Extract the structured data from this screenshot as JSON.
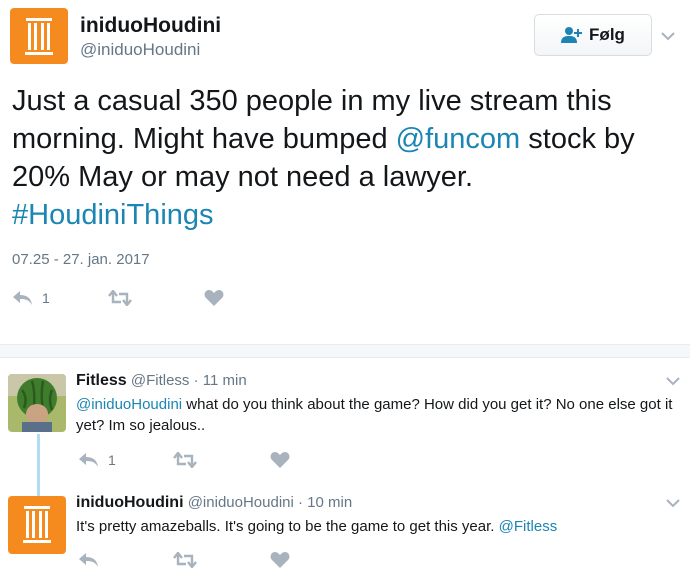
{
  "main_tweet": {
    "author_name": "iniduoHoudini",
    "author_handle": "@iniduoHoudini",
    "follow_label": "Følg",
    "text_parts": [
      {
        "text": "Just a casual 350 people in my live stream this morning. Might have bumped ",
        "kind": "text"
      },
      {
        "text": "@funcom",
        "kind": "link"
      },
      {
        "text": " stock by 20% May or may not need a lawyer. ",
        "kind": "text"
      },
      {
        "text": "#HoudiniThings",
        "kind": "link"
      }
    ],
    "timestamp": "07.25 - 27. jan. 2017",
    "reply_count": "1"
  },
  "replies": [
    {
      "author_name": "Fitless",
      "author_handle": "@Fitless",
      "time": "· 11 min",
      "mention": "@iniduoHoudini",
      "text": " what do you think about the game? How did you get it? No one else got it yet? Im so jealous..",
      "reply_count": "1"
    },
    {
      "author_name": "iniduoHoudini",
      "author_handle": "@iniduoHoudini",
      "time": "· 10 min",
      "text": "It's pretty amazeballs. It's going to be the game to get this year. ",
      "mention": "@Fitless",
      "reply_count": ""
    }
  ],
  "colors": {
    "brand_orange": "#f58a1f",
    "link_blue": "#1b86b4",
    "muted_gray": "#657786",
    "icon_gray": "#a8b3bd"
  },
  "icons": {
    "avatar_logo": "pillar-logo-icon",
    "reply": "reply-arrow-icon",
    "retweet": "retweet-icon",
    "like": "heart-icon",
    "menu": "chevron-down-icon",
    "follow": "add-user-icon"
  }
}
